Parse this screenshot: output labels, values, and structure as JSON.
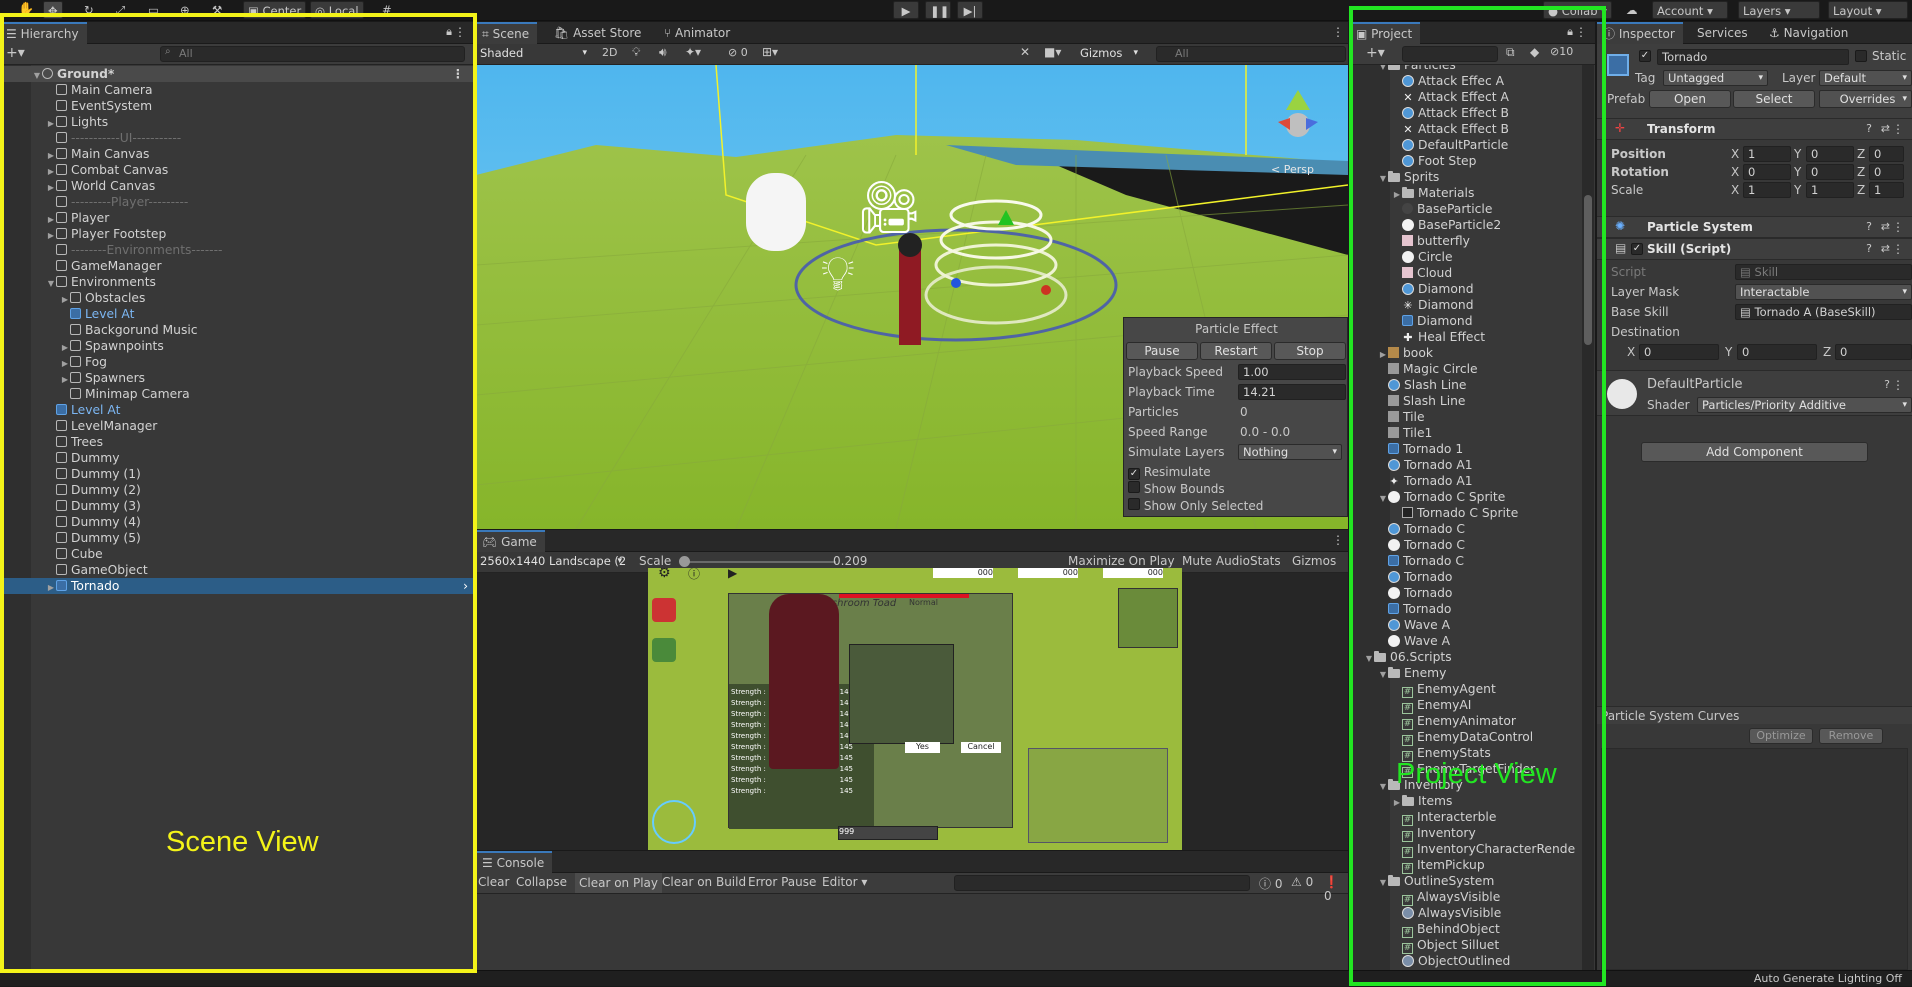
{
  "toolbar": {
    "pivot": "Center",
    "space": "Local",
    "collab": "Collab",
    "account": "Account",
    "layers": "Layers",
    "layout": "Layout"
  },
  "hierarchy": {
    "tab": "Hierarchy",
    "search_placeholder": "All",
    "scene_root": "Ground*",
    "items": [
      {
        "label": "Main Camera",
        "indent": 1,
        "arrow": "",
        "kind": "cube",
        "style": ""
      },
      {
        "label": "EventSystem",
        "indent": 1,
        "arrow": "",
        "kind": "cube",
        "style": ""
      },
      {
        "label": "Lights",
        "indent": 1,
        "arrow": "▶",
        "kind": "cube",
        "style": ""
      },
      {
        "label": "-----------UI-----------",
        "indent": 1,
        "arrow": "",
        "kind": "cube",
        "style": "sep"
      },
      {
        "label": "Main Canvas",
        "indent": 1,
        "arrow": "▶",
        "kind": "cube",
        "style": ""
      },
      {
        "label": "Combat Canvas",
        "indent": 1,
        "arrow": "▶",
        "kind": "cube",
        "style": ""
      },
      {
        "label": "World Canvas",
        "indent": 1,
        "arrow": "▶",
        "kind": "cube",
        "style": ""
      },
      {
        "label": "---------Player---------",
        "indent": 1,
        "arrow": "",
        "kind": "cube",
        "style": "sep"
      },
      {
        "label": "Player",
        "indent": 1,
        "arrow": "▶",
        "kind": "cube",
        "style": ""
      },
      {
        "label": "Player Footstep",
        "indent": 1,
        "arrow": "▶",
        "kind": "cube",
        "style": ""
      },
      {
        "label": "--------Environments-------",
        "indent": 1,
        "arrow": "",
        "kind": "cube",
        "style": "sep"
      },
      {
        "label": "GameManager",
        "indent": 1,
        "arrow": "",
        "kind": "cube",
        "style": ""
      },
      {
        "label": "Environments",
        "indent": 1,
        "arrow": "▼",
        "kind": "cube",
        "style": ""
      },
      {
        "label": "Obstacles",
        "indent": 2,
        "arrow": "▶",
        "kind": "cube",
        "style": ""
      },
      {
        "label": "Level At",
        "indent": 2,
        "arrow": "",
        "kind": "cubeblue",
        "style": "prefab"
      },
      {
        "label": "Backgorund Music",
        "indent": 2,
        "arrow": "",
        "kind": "cube",
        "style": ""
      },
      {
        "label": "Spawnpoints",
        "indent": 2,
        "arrow": "▶",
        "kind": "cube",
        "style": ""
      },
      {
        "label": "Fog",
        "indent": 2,
        "arrow": "▶",
        "kind": "cube",
        "style": ""
      },
      {
        "label": "Spawners",
        "indent": 2,
        "arrow": "▶",
        "kind": "cube",
        "style": ""
      },
      {
        "label": "Minimap Camera",
        "indent": 2,
        "arrow": "",
        "kind": "cube",
        "style": ""
      },
      {
        "label": "Level At",
        "indent": 1,
        "arrow": "",
        "kind": "cubeblue",
        "style": "prefab"
      },
      {
        "label": "LevelManager",
        "indent": 1,
        "arrow": "",
        "kind": "cube",
        "style": ""
      },
      {
        "label": "Trees",
        "indent": 1,
        "arrow": "",
        "kind": "cube",
        "style": ""
      },
      {
        "label": "Dummy",
        "indent": 1,
        "arrow": "",
        "kind": "cube",
        "style": ""
      },
      {
        "label": "Dummy (1)",
        "indent": 1,
        "arrow": "",
        "kind": "cube",
        "style": ""
      },
      {
        "label": "Dummy (2)",
        "indent": 1,
        "arrow": "",
        "kind": "cube",
        "style": ""
      },
      {
        "label": "Dummy (3)",
        "indent": 1,
        "arrow": "",
        "kind": "cube",
        "style": ""
      },
      {
        "label": "Dummy (4)",
        "indent": 1,
        "arrow": "",
        "kind": "cube",
        "style": ""
      },
      {
        "label": "Dummy (5)",
        "indent": 1,
        "arrow": "",
        "kind": "cube",
        "style": ""
      },
      {
        "label": "Cube",
        "indent": 1,
        "arrow": "",
        "kind": "cube",
        "style": ""
      },
      {
        "label": "GameObject",
        "indent": 1,
        "arrow": "",
        "kind": "cube",
        "style": ""
      },
      {
        "label": "Tornado",
        "indent": 1,
        "arrow": "▶",
        "kind": "cubeblue",
        "style": "sel"
      }
    ]
  },
  "scene": {
    "tabs": [
      "Scene",
      "Asset Store",
      "Animator"
    ],
    "shading": "Shaded",
    "mode_2d": "2D",
    "hidden_count": "0",
    "gizmos": "Gizmos",
    "search_placeholder": "All",
    "persp": "< Persp"
  },
  "particle_effect": {
    "title": "Particle Effect",
    "buttons": [
      "Pause",
      "Restart",
      "Stop"
    ],
    "fields": [
      {
        "label": "Playback Speed",
        "value": "1.00",
        "type": "input"
      },
      {
        "label": "Playback Time",
        "value": "14.21",
        "type": "input"
      },
      {
        "label": "Particles",
        "value": "0",
        "type": "text"
      },
      {
        "label": "Speed Range",
        "value": "0.0 - 0.0",
        "type": "text"
      },
      {
        "label": "Simulate Layers",
        "value": "Nothing",
        "type": "drop"
      }
    ],
    "checks": [
      {
        "label": "Resimulate",
        "checked": true
      },
      {
        "label": "Show Bounds",
        "checked": false
      },
      {
        "label": "Show Only Selected",
        "checked": false
      }
    ]
  },
  "game": {
    "tab": "Game",
    "resolution": "2560x1440 Landscape (2",
    "scale_label": "Scale",
    "scale_value": "0.209",
    "buttons": [
      "Maximize On Play",
      "Mute Audio",
      "Stats",
      "Gizmos"
    ],
    "hud_name": "Mushroom Toad",
    "hud_type": "Normal",
    "stat_label": "Strength :",
    "stat_value": "145",
    "stat_rows": 10,
    "hud_count": "999",
    "hud_yes": "Yes",
    "hud_cancel": "Cancel",
    "hud_items": [
      "000",
      "000",
      "000"
    ]
  },
  "console": {
    "tab": "Console",
    "buttons": [
      "Clear",
      "Collapse",
      "Clear on Play",
      "Clear on Build",
      "Error Pause",
      "Editor"
    ],
    "counts": [
      "0",
      "0",
      "0"
    ]
  },
  "project": {
    "tab": "Project",
    "hidden_count": "10",
    "items": [
      {
        "label": "Particles",
        "indent": 2,
        "arrow": "▼",
        "icon": "folder"
      },
      {
        "label": "Attack Effec A",
        "indent": 3,
        "arrow": "",
        "icon": "ps"
      },
      {
        "label": "Attack Effect A",
        "indent": 3,
        "arrow": "",
        "icon": "x"
      },
      {
        "label": "Attack Effect B",
        "indent": 3,
        "arrow": "",
        "icon": "ps"
      },
      {
        "label": "Attack Effect B",
        "indent": 3,
        "arrow": "",
        "icon": "x"
      },
      {
        "label": "DefaultParticle",
        "indent": 3,
        "arrow": "",
        "icon": "ps"
      },
      {
        "label": "Foot Step",
        "indent": 3,
        "arrow": "",
        "icon": "ps"
      },
      {
        "label": "Sprits",
        "indent": 2,
        "arrow": "▼",
        "icon": "folder"
      },
      {
        "label": "Materials",
        "indent": 3,
        "arrow": "▶",
        "icon": "folder"
      },
      {
        "label": "BaseParticle",
        "indent": 3,
        "arrow": "",
        "icon": "dot"
      },
      {
        "label": "BaseParticle2",
        "indent": 3,
        "arrow": "",
        "icon": "white"
      },
      {
        "label": "butterfly",
        "indent": 3,
        "arrow": "",
        "icon": "pink"
      },
      {
        "label": "Circle",
        "indent": 3,
        "arrow": "",
        "icon": "white"
      },
      {
        "label": "Cloud",
        "indent": 3,
        "arrow": "",
        "icon": "pink"
      },
      {
        "label": "Diamond",
        "indent": 3,
        "arrow": "",
        "icon": "ps"
      },
      {
        "label": "Diamond",
        "indent": 3,
        "arrow": "",
        "icon": "star"
      },
      {
        "label": "Diamond",
        "indent": 3,
        "arrow": "",
        "icon": "cube"
      },
      {
        "label": "Heal Effect",
        "indent": 3,
        "arrow": "",
        "icon": "plus"
      },
      {
        "label": "book",
        "indent": 2,
        "arrow": "▶",
        "icon": "book"
      },
      {
        "label": "Magic Circle",
        "indent": 2,
        "arrow": "",
        "icon": "skull"
      },
      {
        "label": "Slash Line",
        "indent": 2,
        "arrow": "",
        "icon": "ps"
      },
      {
        "label": "Slash Line",
        "indent": 2,
        "arrow": "",
        "icon": "slash"
      },
      {
        "label": "Tile",
        "indent": 2,
        "arrow": "",
        "icon": "grey"
      },
      {
        "label": "Tile1",
        "indent": 2,
        "arrow": "",
        "icon": "grey"
      },
      {
        "label": "Tornado 1",
        "indent": 2,
        "arrow": "",
        "icon": "cube"
      },
      {
        "label": "Tornado A1",
        "indent": 2,
        "arrow": "",
        "icon": "ps"
      },
      {
        "label": "Tornado A1",
        "indent": 2,
        "arrow": "",
        "icon": "spark"
      },
      {
        "label": "Tornado C Sprite",
        "indent": 2,
        "arrow": "▼",
        "icon": "white"
      },
      {
        "label": "Tornado C Sprite",
        "indent": 3,
        "arrow": "",
        "icon": "csprite"
      },
      {
        "label": "Tornado C",
        "indent": 2,
        "arrow": "",
        "icon": "ps"
      },
      {
        "label": "Tornado C",
        "indent": 2,
        "arrow": "",
        "icon": "white"
      },
      {
        "label": "Tornado C",
        "indent": 2,
        "arrow": "",
        "icon": "cube"
      },
      {
        "label": "Tornado",
        "indent": 2,
        "arrow": "",
        "icon": "ps"
      },
      {
        "label": "Tornado",
        "indent": 2,
        "arrow": "",
        "icon": "ring"
      },
      {
        "label": "Tornado",
        "indent": 2,
        "arrow": "",
        "icon": "cube"
      },
      {
        "label": "Wave A",
        "indent": 2,
        "arrow": "",
        "icon": "ps"
      },
      {
        "label": "Wave A",
        "indent": 2,
        "arrow": "",
        "icon": "white"
      },
      {
        "label": "06.Scripts",
        "indent": 1,
        "arrow": "▼",
        "icon": "folder"
      },
      {
        "label": "Enemy",
        "indent": 2,
        "arrow": "▼",
        "icon": "folder"
      },
      {
        "label": "EnemyAgent",
        "indent": 3,
        "arrow": "",
        "icon": "hash"
      },
      {
        "label": "EnemyAI",
        "indent": 3,
        "arrow": "",
        "icon": "hash"
      },
      {
        "label": "EnemyAnimator",
        "indent": 3,
        "arrow": "",
        "icon": "hash"
      },
      {
        "label": "EnemyDataControl",
        "indent": 3,
        "arrow": "",
        "icon": "hash"
      },
      {
        "label": "EnemyStats",
        "indent": 3,
        "arrow": "",
        "icon": "hash"
      },
      {
        "label": "EnemyTargetFinder",
        "indent": 3,
        "arrow": "",
        "icon": "hash"
      },
      {
        "label": "Inventory",
        "indent": 2,
        "arrow": "▼",
        "icon": "folder"
      },
      {
        "label": "Items",
        "indent": 3,
        "arrow": "▶",
        "icon": "folder"
      },
      {
        "label": "Interacterble",
        "indent": 3,
        "arrow": "",
        "icon": "hash"
      },
      {
        "label": "Inventory",
        "indent": 3,
        "arrow": "",
        "icon": "hash"
      },
      {
        "label": "InventoryCharacterRende",
        "indent": 3,
        "arrow": "",
        "icon": "hash"
      },
      {
        "label": "ItemPickup",
        "indent": 3,
        "arrow": "",
        "icon": "hash"
      },
      {
        "label": "OutlineSystem",
        "indent": 2,
        "arrow": "▼",
        "icon": "folder"
      },
      {
        "label": "AlwaysVisible",
        "indent": 3,
        "arrow": "",
        "icon": "hash"
      },
      {
        "label": "AlwaysVisible",
        "indent": 3,
        "arrow": "",
        "icon": "shader"
      },
      {
        "label": "BehindObject",
        "indent": 3,
        "arrow": "",
        "icon": "hash"
      },
      {
        "label": "Object Silluet",
        "indent": 3,
        "arrow": "",
        "icon": "hash"
      },
      {
        "label": "ObjectOutlined",
        "indent": 3,
        "arrow": "",
        "icon": "shader"
      }
    ]
  },
  "inspector": {
    "tabs": [
      "Inspector",
      "Services",
      "Navigation"
    ],
    "object_name": "Tornado",
    "static_label": "Static",
    "tag_label": "Tag",
    "tag_value": "Untagged",
    "layer_label": "Layer",
    "layer_value": "Default",
    "prefab_label": "Prefab",
    "prefab_open": "Open",
    "prefab_select": "Select",
    "prefab_overrides": "Overrides",
    "transform": {
      "title": "Transform",
      "rows": [
        {
          "label": "Position",
          "x": "1",
          "y": "0",
          "z": "0"
        },
        {
          "label": "Rotation",
          "x": "0",
          "y": "0",
          "z": "0"
        },
        {
          "label": "Scale",
          "x": "1",
          "y": "1",
          "z": "1"
        }
      ]
    },
    "particle_system_title": "Particle System",
    "skill": {
      "title": "Skill (Script)",
      "script_label": "Script",
      "script_value": "Skill",
      "layer_mask_label": "Layer Mask",
      "layer_mask_value": "Interactable",
      "base_skill_label": "Base Skill",
      "base_skill_value": "Tornado A (BaseSkill)",
      "destination_label": "Destination",
      "dest_x": "0",
      "dest_y": "0",
      "dest_z": "0"
    },
    "material": {
      "name": "DefaultParticle",
      "shader_label": "Shader",
      "shader_value": "Particles/Priority Additive"
    },
    "add_component": "Add Component",
    "curves_title": "Particle System Curves",
    "optimize": "Optimize",
    "remove": "Remove"
  },
  "status": {
    "text": "Auto Generate Lighting Off"
  },
  "annotations": {
    "scene_view": "Scene View",
    "project_view": "Project View",
    "yellow": "#f3f319",
    "green": "#22e622"
  }
}
